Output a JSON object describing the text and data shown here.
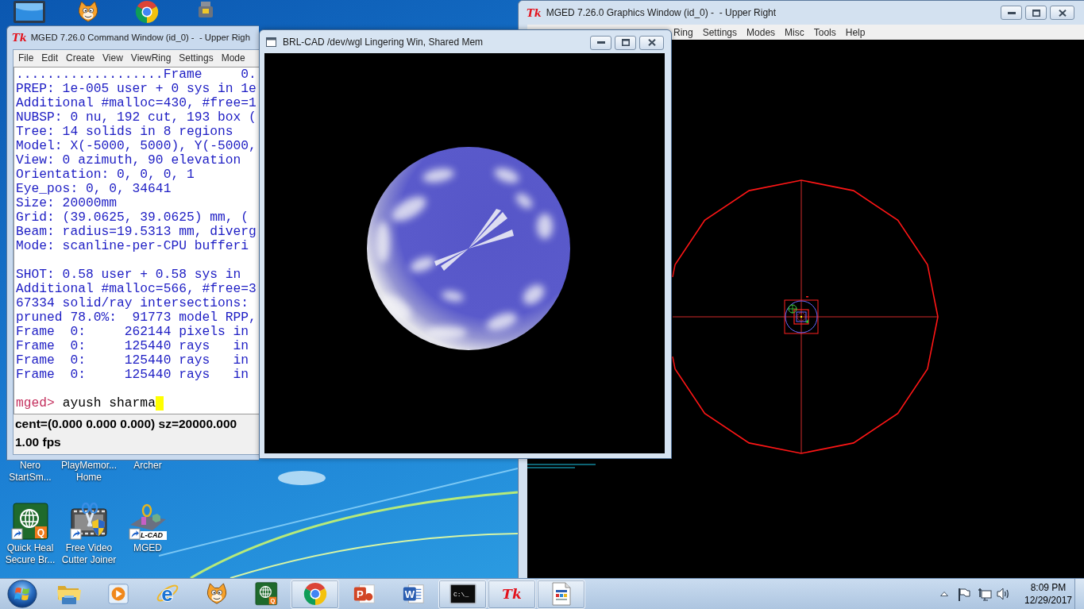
{
  "desktop_top_icons": [
    {
      "kind": "computer"
    },
    {
      "kind": "cat"
    },
    {
      "kind": "browser"
    },
    {
      "kind": "gadget"
    }
  ],
  "command_window": {
    "icon_text": "Tk",
    "title": "MGED 7.26.0 Command Window (id_0) -  - Upper Righ",
    "menu": [
      "File",
      "Edit",
      "Create",
      "View",
      "ViewRing",
      "Settings",
      "Mode"
    ],
    "console_blocks": [
      [
        "...................Frame     0.",
        "PREP: 1e-005 user + 0 sys in 1e",
        "Additional #malloc=430, #free=1",
        "NUBSP: 0 nu, 192 cut, 193 box (",
        "Tree: 14 solids in 8 regions",
        "Model: X(-5000, 5000), Y(-5000,",
        "View: 0 azimuth, 90 elevation",
        "Orientation: 0, 0, 0, 1",
        "Eye_pos: 0, 0, 34641",
        "Size: 20000mm",
        "Grid: (39.0625, 39.0625) mm, (",
        "Beam: radius=19.5313 mm, diverg",
        "Mode: scanline-per-CPU bufferi"
      ],
      [
        "SHOT: 0.58 user + 0.58 sys in",
        "Additional #malloc=566, #free=3",
        "67334 solid/ray intersections:",
        "pruned 78.0%:  91773 model RPP,",
        "Frame  0:     262144 pixels in",
        "Frame  0:     125440 rays   in",
        "Frame  0:     125440 rays   in",
        "Frame  0:     125440 rays   in"
      ]
    ],
    "prompt": "mged>",
    "input": "ayush sharma",
    "cursor": true,
    "status_lines": [
      "cent=(0.000 0.000 0.000) sz=20000.000",
      "1.00 fps"
    ]
  },
  "raytrace_window": {
    "title": "BRL-CAD /dev/wgl Lingering Win, Shared Mem"
  },
  "graphics_window": {
    "icon_text": "Tk",
    "title": "MGED 7.26.0 Graphics Window (id_0) -  - Upper Right",
    "menu": [
      "Ring",
      "Settings",
      "Modes",
      "Misc",
      "Tools",
      "Help"
    ]
  },
  "desktop_icons": [
    {
      "kind": "covered",
      "label": [
        "Nero",
        "StartSm..."
      ]
    },
    {
      "kind": "covered",
      "label": [
        "PlayMemor...",
        "Home"
      ]
    },
    {
      "kind": "covered",
      "label": [
        "Archer"
      ]
    },
    {
      "kind": "globe_tile",
      "badge": "Q",
      "shortcut": true,
      "label": [
        "Quick Heal",
        "Secure Br..."
      ]
    },
    {
      "kind": "film_scissors",
      "shortcut": true,
      "label": [
        "Free Video",
        "Cutter Joiner"
      ]
    },
    {
      "kind": "cad",
      "badge": "L-CAD",
      "shortcut": true,
      "label": [
        "MGED"
      ]
    }
  ],
  "taskbar": {
    "items": [
      {
        "kind": "folder",
        "open": false
      },
      {
        "kind": "player",
        "open": false
      },
      {
        "kind": "ie",
        "icon_text": "e",
        "open": false
      },
      {
        "kind": "cat",
        "open": false
      },
      {
        "kind": "globe_tile",
        "icon_text": "Q",
        "open": false
      },
      {
        "kind": "browser",
        "open": true
      },
      {
        "kind": "slides",
        "icon_text": "P",
        "open": false
      },
      {
        "kind": "document",
        "icon_text": "W",
        "open": false
      },
      {
        "kind": "terminal",
        "icon_text": "C:\\_",
        "open": true
      },
      {
        "kind": "tk",
        "icon_text": "Tk",
        "open": true
      },
      {
        "kind": "page",
        "open": true
      }
    ],
    "tray": {
      "time": "8:09 PM",
      "date": "12/29/2017"
    }
  }
}
